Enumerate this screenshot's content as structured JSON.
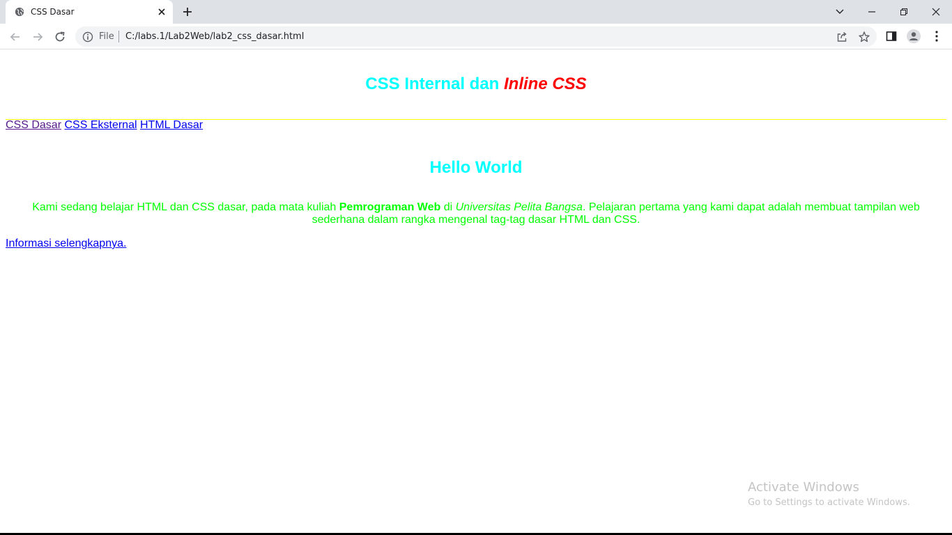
{
  "browser": {
    "tab_title": "CSS Dasar",
    "scheme_label": "File",
    "url": "C:/labs.1/Lab2Web/lab2_css_dasar.html"
  },
  "page": {
    "heading1_part1": "CSS Internal dan ",
    "heading1_part2": "Inline CSS",
    "nav_links": [
      "CSS Dasar",
      "CSS Eksternal",
      "HTML Dasar"
    ],
    "heading2": "Hello World",
    "paragraph": {
      "text1": "Kami sedang belajar HTML dan CSS dasar, pada mata kuliah ",
      "bold": "Pemrograman Web",
      "text2": " di ",
      "italic": "Universitas Pelita Bangsa",
      "text3": ". Pelajaran pertama yang kami dapat adalah membuat tampilan web sederhana dalam rangka mengenal tag-tag dasar HTML dan CSS."
    },
    "more_link": "Informasi selengkapnya."
  },
  "watermark": {
    "title": "Activate Windows",
    "subtitle": "Go to Settings to activate Windows."
  },
  "colors": {
    "heading": "#00ffff",
    "heading_inline": "#ff0000",
    "paragraph": "#00ff00",
    "rule": "#ffff00",
    "link": "#0000ee",
    "visited_link": "#551a8b"
  }
}
